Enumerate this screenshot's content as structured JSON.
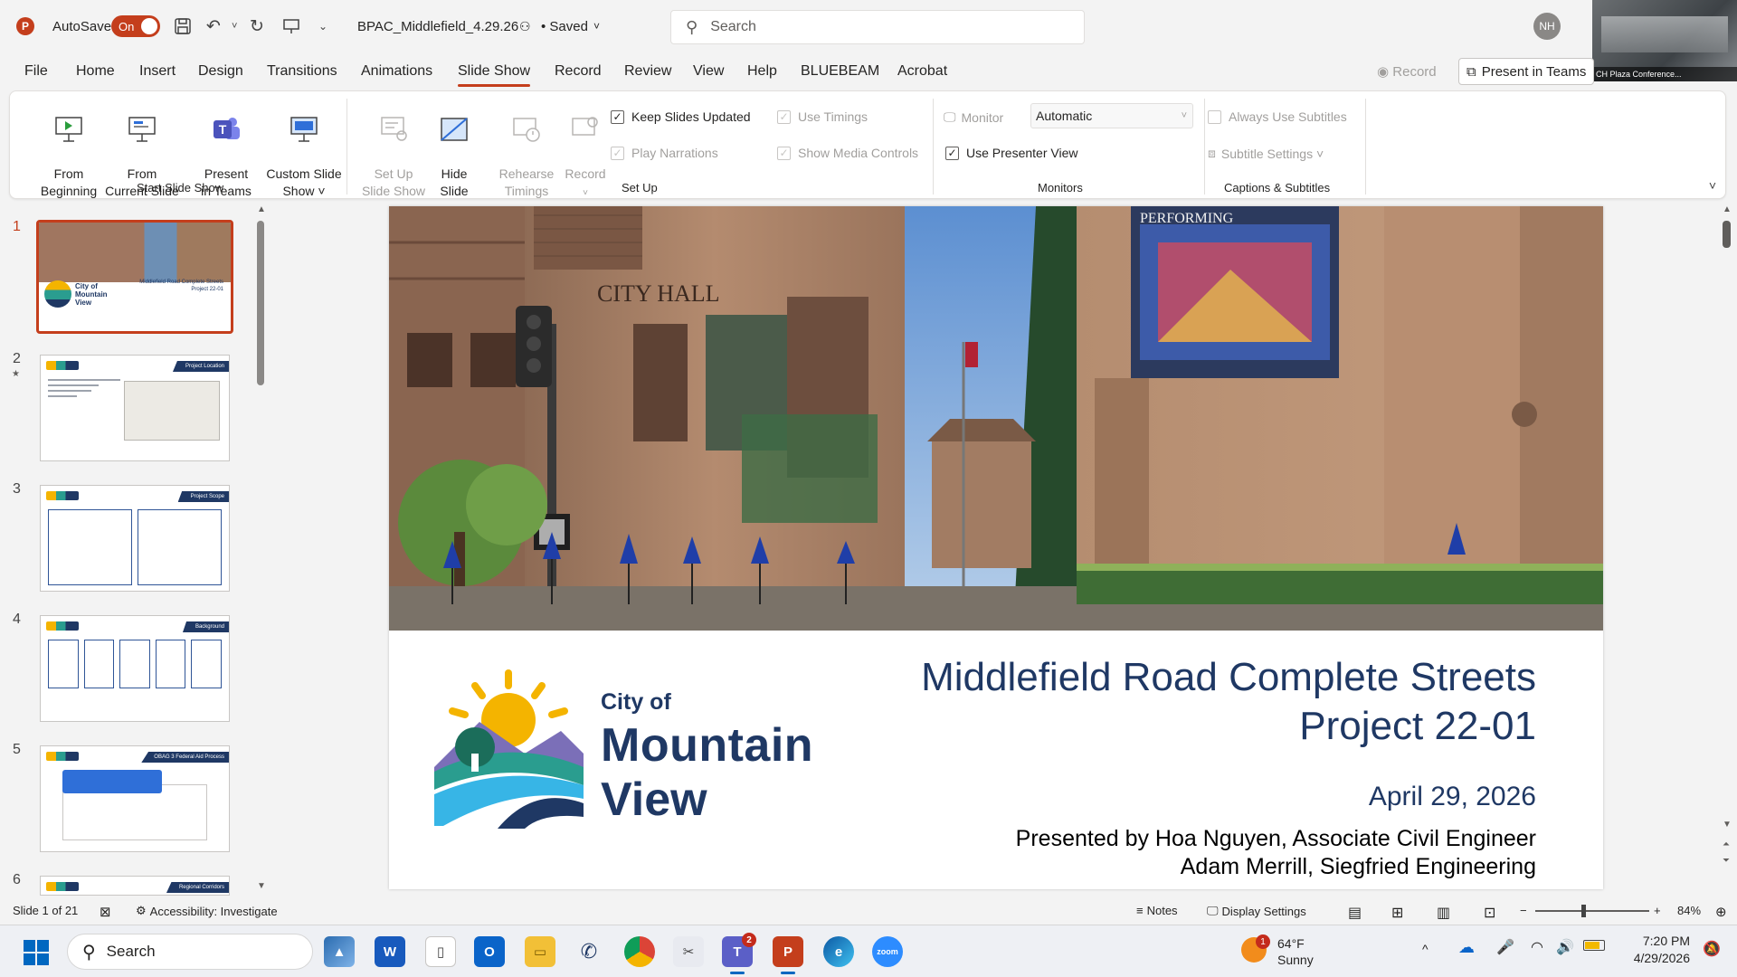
{
  "titlebar": {
    "autosave_label": "AutoSave",
    "autosave_state": "On",
    "document_name": "BPAC_Middlefield_4.29.26",
    "saved_label": "• Saved",
    "search_placeholder": "Search",
    "user_initials": "NH",
    "teams_window_label": "CH Plaza Conference..."
  },
  "tabs": [
    "File",
    "Home",
    "Insert",
    "Design",
    "Transitions",
    "Animations",
    "Slide Show",
    "Record",
    "Review",
    "View",
    "Help",
    "BLUEBEAM",
    "Acrobat"
  ],
  "active_tab": "Slide Show",
  "tab_right": {
    "record": "Record",
    "present_in_teams": "Present in Teams"
  },
  "ribbon": {
    "start": {
      "from_beginning": "From\nBeginning",
      "from_current": "From\nCurrent Slide",
      "present_teams": "Present\nin Teams",
      "custom_show": "Custom Slide\nShow ˅",
      "label": "Start Slide Show"
    },
    "setup": {
      "set_up": "Set Up\nSlide Show",
      "hide_slide": "Hide\nSlide",
      "rehearse": "Rehearse\nTimings",
      "record": "Record",
      "keep_updated": "Keep Slides Updated",
      "use_timings": "Use Timings",
      "play_narrations": "Play Narrations",
      "show_media": "Show Media Controls",
      "label": "Set Up"
    },
    "monitors": {
      "monitor": "Monitor",
      "monitor_value": "Automatic",
      "presenter_view": "Use Presenter View",
      "label": "Monitors"
    },
    "captions": {
      "always_subtitles": "Always Use Subtitles",
      "subtitle_settings": "Subtitle Settings ˅",
      "label": "Captions & Subtitles"
    }
  },
  "thumbnails": [
    {
      "num": "1",
      "title": "Middlefield Road Complete Streets Project 22-01"
    },
    {
      "num": "2",
      "title": "Project Location"
    },
    {
      "num": "3",
      "title": "Project Scope"
    },
    {
      "num": "4",
      "title": "Background"
    },
    {
      "num": "5",
      "title": "OBAG 3 Federal Aid Process"
    },
    {
      "num": "6",
      "title": "Regional Corridors"
    }
  ],
  "slide": {
    "photo_sign_city_hall": "CITY HALL",
    "photo_sign_performing": "PERFORMING",
    "logo_city_of": "City of",
    "logo_mountain": "Mountain",
    "logo_view": "View",
    "title_line1": "Middlefield Road Complete Streets",
    "title_line2": "Project 22-01",
    "date": "April 29, 2026",
    "presenter_line1": "Presented by Hoa Nguyen, Associate Civil Engineer",
    "presenter_line2": "Adam Merrill, Siegfried Engineering"
  },
  "statusbar": {
    "slide_count": "Slide 1 of 21",
    "accessibility": "Accessibility: Investigate",
    "notes": "Notes",
    "display_settings": "Display Settings",
    "zoom": "84%"
  },
  "taskbar": {
    "search": "Search",
    "teams_badge": "2",
    "weather_badge": "1",
    "temperature": "64°F",
    "condition": "Sunny",
    "time": "7:20 PM",
    "date": "4/29/2026"
  },
  "colors": {
    "accent": "#c43e1c",
    "slide_title": "#1f3864"
  }
}
